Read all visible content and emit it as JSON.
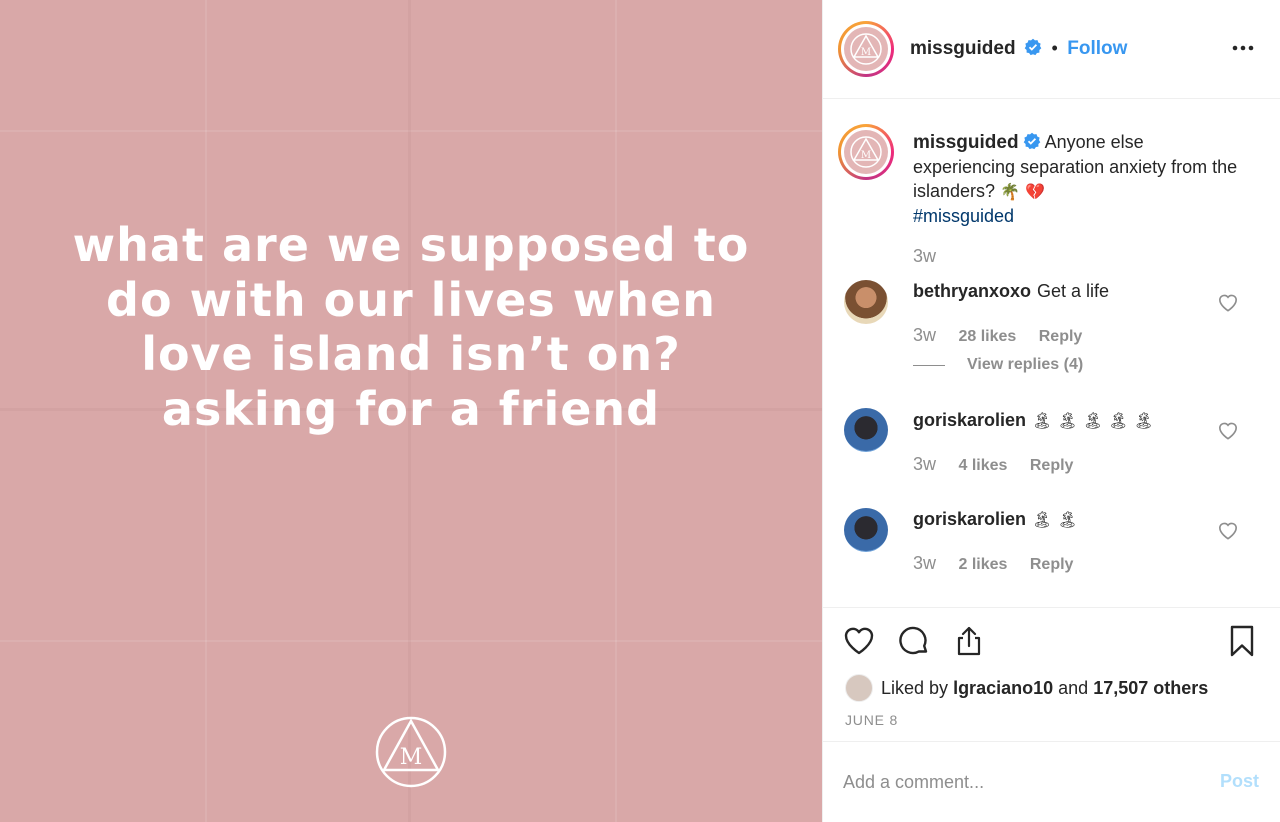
{
  "post": {
    "quote": "what are we supposed to do with our lives when love island isn’t on? asking for a friend"
  },
  "header": {
    "username": "missguided",
    "separator": "•",
    "follow_label": "Follow"
  },
  "caption": {
    "username": "missguided",
    "text": "Anyone else experiencing separation anxiety from the islanders?",
    "emojis": "🌴 💔",
    "hashtag": "#missguided",
    "time": "3w"
  },
  "comments": [
    {
      "username": "bethryanxoxo",
      "text": "Get a life",
      "time": "3w",
      "likes": "28 likes",
      "reply": "Reply",
      "view_replies": "View replies (4)"
    },
    {
      "username": "goriskarolien",
      "text": "🏝 🏝 🏝 🏝 🏝",
      "time": "3w",
      "likes": "4 likes",
      "reply": "Reply"
    },
    {
      "username": "goriskarolien",
      "text": "🏝 🏝",
      "time": "3w",
      "likes": "2 likes",
      "reply": "Reply"
    }
  ],
  "likes": {
    "prefix": "Liked by",
    "user": "lgraciano10",
    "and": "and",
    "others": "17,507 others"
  },
  "date": "JUNE 8",
  "add_comment": {
    "placeholder": "Add a comment...",
    "post_label": "Post"
  },
  "colors": {
    "accent": "#3897f0",
    "image_bg": "#d9a8a8",
    "hashtag": "#00376b",
    "muted": "#8e8e8e"
  },
  "icons": [
    "more-options-icon",
    "verified-badge-icon",
    "heart-icon",
    "comment-icon",
    "share-icon",
    "bookmark-icon",
    "brand-logo-icon"
  ]
}
